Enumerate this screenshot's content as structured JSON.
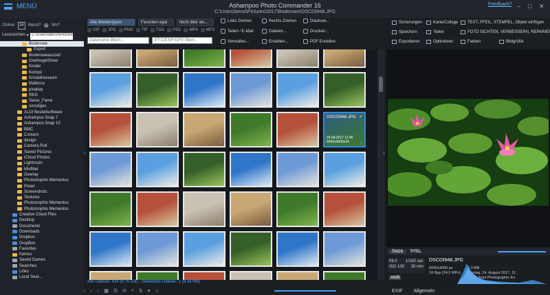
{
  "titlebar": {
    "menu_label": "MENÜ",
    "app_title": "Ashampoo Photo Commander 16",
    "path": "C:\\Users\\bensl\\Pictures\\2017\\Bodensee\\DSC03948.JPG",
    "feedback": "Feedback?",
    "controls": [
      "–",
      "□",
      "✕"
    ]
  },
  "left": {
    "ordner": "Ordner",
    "day": "24",
    "wann": "Wann?",
    "wo": "Wo?",
    "lesezeichen": "Lesezeichen",
    "path_value": "C:\\Users\\bensl\\Pictures\\",
    "tree": [
      {
        "label": "Bodensee",
        "selected": true,
        "indent": 2
      },
      {
        "label": "Export",
        "indent": 3
      },
      {
        "label": "Bodenseeauszeit",
        "indent": 2
      },
      {
        "label": "GreifvogelShow",
        "indent": 2
      },
      {
        "label": "Kinder",
        "indent": 2
      },
      {
        "label": "Kompo",
        "indent": 2
      },
      {
        "label": "Kristallmuseum",
        "indent": 2
      },
      {
        "label": "Mallorca",
        "indent": 2
      },
      {
        "label": "pixabay",
        "indent": 2
      },
      {
        "label": "RKG",
        "indent": 2
      },
      {
        "label": "Saras_Fame",
        "indent": 2
      },
      {
        "label": "sonstiges",
        "indent": 2
      },
      {
        "label": "ALDI Bestellsoftware",
        "indent": 1
      },
      {
        "label": "Ashampoo Snap 7",
        "indent": 1
      },
      {
        "label": "Ashampoo Snap 10",
        "indent": 1
      },
      {
        "label": "BMC",
        "indent": 1
      },
      {
        "label": "Content",
        "indent": 1
      },
      {
        "label": "design",
        "indent": 1
      },
      {
        "label": "Camera Roll",
        "indent": 1
      },
      {
        "label": "Saved Pictures",
        "indent": 1
      },
      {
        "label": "iCloud Photos",
        "indent": 1
      },
      {
        "label": "Lightroom",
        "indent": 1
      },
      {
        "label": "Mixfibel",
        "indent": 1
      },
      {
        "label": "Overlay",
        "indent": 1
      },
      {
        "label": "Photomophis Mementos",
        "indent": 1
      },
      {
        "label": "Polarr",
        "indent": 1
      },
      {
        "label": "Screenshots",
        "indent": 1
      },
      {
        "label": "Textures",
        "indent": 1
      },
      {
        "label": "Photomophis Mementos",
        "indent": 1
      },
      {
        "label": "Photomophis Mementos",
        "indent": 1
      },
      {
        "label": "Creative Cloud Files",
        "indent": 0,
        "kind": "blue"
      },
      {
        "label": "Desktop",
        "indent": 0,
        "kind": "blue"
      },
      {
        "label": "Documents",
        "indent": 0,
        "kind": "special"
      },
      {
        "label": "Downloads",
        "indent": 0,
        "kind": "blue"
      },
      {
        "label": "Dropbox",
        "indent": 0,
        "kind": "blue"
      },
      {
        "label": "DropBox",
        "indent": 0,
        "kind": "blue"
      },
      {
        "label": "Favorites",
        "indent": 0,
        "kind": "special"
      },
      {
        "label": "frames",
        "indent": 0
      },
      {
        "label": "Saved Games",
        "indent": 0,
        "kind": "special"
      },
      {
        "label": "Searches",
        "indent": 0,
        "kind": "special"
      },
      {
        "label": "Links",
        "indent": 0,
        "kind": "blue"
      },
      {
        "label": "Local Sear...",
        "indent": 0,
        "kind": "special"
      }
    ]
  },
  "filters": {
    "media": "Alle Medientypen",
    "favorites": "Favoriten egal",
    "age": "Nicht älter als...",
    "types": [
      "GIF",
      "JPG",
      "PNG",
      "TIF",
      "TGA",
      "PSD",
      "MP4",
      "MP3"
    ],
    "name_placeholder": "Dateiname filtern...",
    "meta_placeholder": "IPTC/EXIF/GPS filtern..."
  },
  "actions": {
    "row1": [
      "Links Drehen",
      "Rechts Drehen",
      "Diashow..."
    ],
    "row2": [
      "Teilen / E-Mail",
      "Dateien...",
      "Drucken..."
    ],
    "row3": [
      "Verwalten...",
      "Erstellen...",
      "PDF Erstellen"
    ]
  },
  "grid": {
    "selected_caption": "DSC03948.JPG",
    "selected_info_1": "24.08.2017 11:46",
    "selected_info_2": "6000x4000x24"
  },
  "status": {
    "text": "Alle Dateien: 434 (6.76 GB) - Selektierte Dateien: 1 (6.34 MB)"
  },
  "right": {
    "tools": [
      "Sicherungen",
      "Karte/Collage",
      "TEXT, PFEIL, STEMPEL, Objekt einfügen",
      "Speichern",
      "Teilen",
      "FOTO SICHTEN, VERBESSERN, REPARIER",
      "Exportieren",
      "Optimieren",
      "Farben",
      "Bildgröße"
    ],
    "tabs": [
      "TAGS",
      "TITEL"
    ],
    "exif": {
      "fstop": "f/8.0",
      "shutter": "1/160 sec",
      "iso": "ISO 100",
      "focal": "35 mm",
      "filename": "DSC03948.JPG",
      "res": "6000x4000 px",
      "bpp": "24 Bpp (24.0 MPx)",
      "size": "6.3 MB",
      "date": "Montag, 24. August 2017, 11:",
      "type": "JPG - Joint Photographic Ex"
    },
    "footer": [
      "EXIF",
      "Allgemein"
    ]
  },
  "colors": {
    "accent": "#4aa3ff",
    "background": "#1b1e23",
    "selection": "#2f8fe0"
  }
}
